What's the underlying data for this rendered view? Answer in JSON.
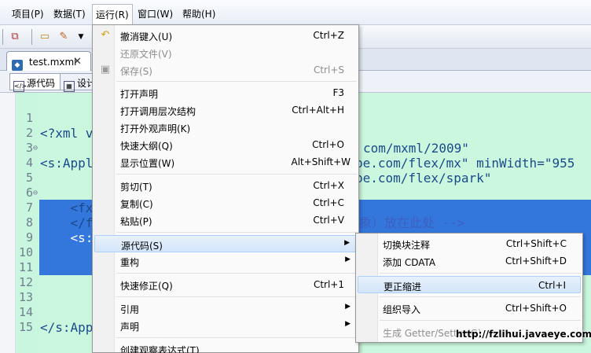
{
  "menubar": {
    "items": [
      "项目(P)",
      "数据(T)",
      "运行(R)",
      "窗口(W)",
      "帮助(H)"
    ]
  },
  "editor_tabs": {
    "file_tab": "test.mxml",
    "sub_tabs": [
      "源代码",
      "设计"
    ]
  },
  "code_lines": [
    {
      "num": "1",
      "text": "<?xml v",
      "frag": "com/mxml/2009\""
    },
    {
      "num": "2",
      "text": "<s:Appl",
      "frag": "be.com/flex/spark\""
    },
    {
      "num": "3",
      "text": "",
      "frag": "be.com/flex/mx\" minWidth=\"955"
    },
    {
      "num": "4",
      "text": "",
      "frag": ""
    },
    {
      "num": "5",
      "text": "    <fx",
      "frag": "象）放在此处 -->"
    },
    {
      "num": "6",
      "text": "",
      "frag": ""
    },
    {
      "num": "7",
      "text": "    </f",
      "frag": ""
    },
    {
      "num": "8",
      "text": "    <s:",
      "frag": ""
    },
    {
      "num": "9",
      "text": "",
      "frag": ""
    },
    {
      "num": "10",
      "text": "",
      "frag": ""
    },
    {
      "num": "11",
      "text": "",
      "frag": ""
    },
    {
      "num": "12",
      "text": "",
      "frag": ""
    },
    {
      "num": "13",
      "text": "",
      "frag": ""
    },
    {
      "num": "14",
      "text": "</s:App",
      "frag": ""
    },
    {
      "num": "15",
      "text": "",
      "frag": ""
    }
  ],
  "context_menu": {
    "items": [
      {
        "label": "撤消键入(U)",
        "shortcut": "Ctrl+Z",
        "icon": "undo-icon"
      },
      {
        "label": "还原文件(V)",
        "shortcut": "",
        "disabled": true
      },
      {
        "label": "保存(S)",
        "shortcut": "Ctrl+S",
        "disabled": true,
        "icon": "save-icon"
      },
      {
        "label": "打开声明",
        "shortcut": "F3"
      },
      {
        "label": "打开调用层次结构",
        "shortcut": "Ctrl+Alt+H"
      },
      {
        "label": "打开外观声明(K)",
        "shortcut": ""
      },
      {
        "label": "快速大纲(Q)",
        "shortcut": "Ctrl+O"
      },
      {
        "label": "显示位置(W)",
        "shortcut": "Alt+Shift+W"
      },
      {
        "label": "剪切(T)",
        "shortcut": "Ctrl+X"
      },
      {
        "label": "复制(C)",
        "shortcut": "Ctrl+C"
      },
      {
        "label": "粘贴(P)",
        "shortcut": "Ctrl+V"
      },
      {
        "label": "源代码(S)",
        "shortcut": "",
        "submenu": true
      },
      {
        "label": "重构",
        "shortcut": "",
        "submenu": true
      },
      {
        "label": "快速修正(Q)",
        "shortcut": "Ctrl+1"
      },
      {
        "label": "引用",
        "shortcut": "",
        "submenu": true
      },
      {
        "label": "声明",
        "shortcut": "",
        "submenu": true
      },
      {
        "label": "创建观察表达式(T)",
        "shortcut": ""
      }
    ]
  },
  "source_submenu": {
    "items": [
      {
        "label": "切换块注释",
        "shortcut": "Ctrl+Shift+C"
      },
      {
        "label": "添加 CDATA",
        "shortcut": "Ctrl+Shift+D"
      },
      {
        "label": "更正缩进",
        "shortcut": "Ctrl+I"
      },
      {
        "label": "组织导入",
        "shortcut": "Ctrl+Shift+O"
      },
      {
        "label": "生成 Getter/Setter(G)",
        "shortcut": "",
        "disabled": true
      }
    ]
  },
  "watermark": "http://fzlihui.javaeye.com/",
  "colors": {
    "editor_bg": "#cbf7df",
    "selection": "#3377dd",
    "highlight": "#d3e5f9"
  }
}
